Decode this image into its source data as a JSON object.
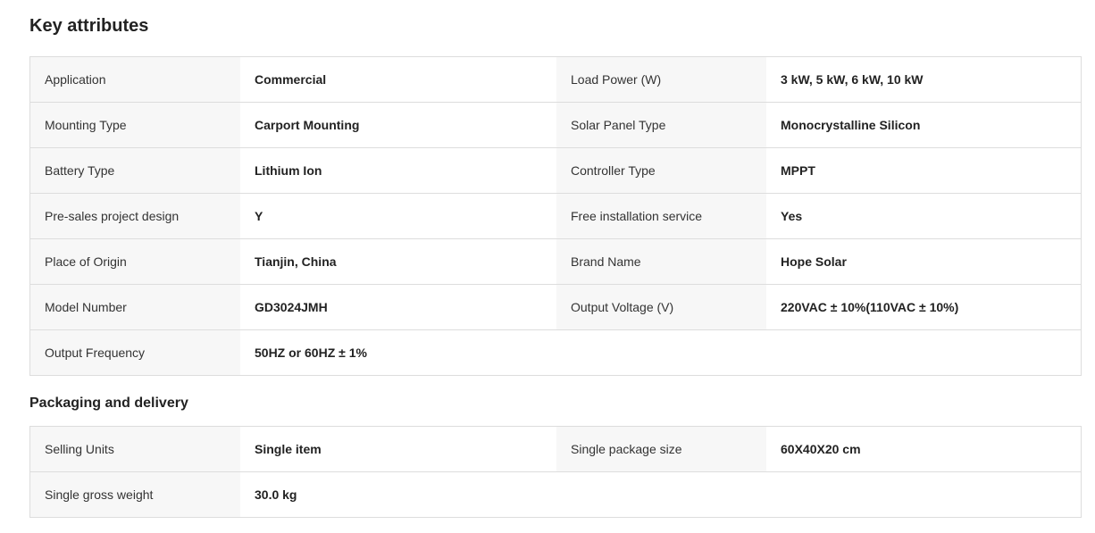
{
  "key_attributes": {
    "title": "Key attributes",
    "rows": [
      {
        "label1": "Application",
        "value1": "Commercial",
        "label2": "Load Power (W)",
        "value2": "3 kW, 5 kW, 6 kW, 10 kW"
      },
      {
        "label1": "Mounting Type",
        "value1": "Carport Mounting",
        "label2": "Solar Panel Type",
        "value2": "Monocrystalline Silicon"
      },
      {
        "label1": "Battery Type",
        "value1": "Lithium Ion",
        "label2": "Controller Type",
        "value2": "MPPT"
      },
      {
        "label1": "Pre-sales project design",
        "value1": "Y",
        "label2": "Free installation service",
        "value2": "Yes"
      },
      {
        "label1": "Place of Origin",
        "value1": "Tianjin, China",
        "label2": "Brand Name",
        "value2": "Hope Solar"
      },
      {
        "label1": "Model Number",
        "value1": "GD3024JMH",
        "label2": "Output Voltage (V)",
        "value2": "220VAC ± 10%(110VAC ± 10%)"
      },
      {
        "label1": "Output Frequency",
        "value1": "50HZ or 60HZ ± 1%",
        "label2": "",
        "value2": ""
      }
    ]
  },
  "packaging": {
    "title": "Packaging and delivery",
    "rows": [
      {
        "label1": "Selling Units",
        "value1": "Single item",
        "label2": "Single package size",
        "value2": "60X40X20 cm"
      },
      {
        "label1": "Single gross weight",
        "value1": "30.0 kg",
        "label2": "",
        "value2": ""
      }
    ]
  }
}
